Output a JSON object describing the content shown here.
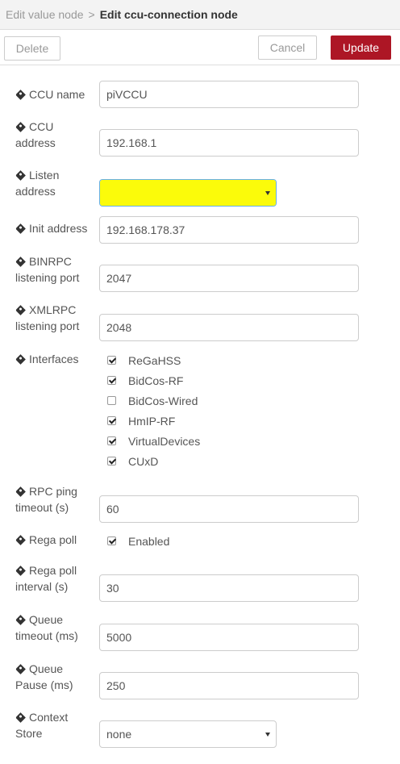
{
  "header": {
    "parent": "Edit value node",
    "separator": ">",
    "current": "Edit ccu-connection node"
  },
  "toolbar": {
    "delete_label": "Delete",
    "cancel_label": "Cancel",
    "update_label": "Update"
  },
  "form": {
    "ccu_name": {
      "label": "CCU name",
      "value": "piVCCU"
    },
    "ccu_address": {
      "label": "CCU address",
      "value": "192.168.1"
    },
    "listen_address": {
      "label": "Listen address",
      "value": ""
    },
    "init_address": {
      "label": "Init address",
      "value": "192.168.178.37"
    },
    "binrpc_port": {
      "label": "BINRPC listening port",
      "value": "2047"
    },
    "xmlrpc_port": {
      "label": "XMLRPC listening port",
      "value": "2048"
    },
    "interfaces": {
      "label": "Interfaces",
      "items": [
        {
          "label": "ReGaHSS",
          "checked": true
        },
        {
          "label": "BidCos-RF",
          "checked": true
        },
        {
          "label": "BidCos-Wired",
          "checked": false
        },
        {
          "label": "HmIP-RF",
          "checked": true
        },
        {
          "label": "VirtualDevices",
          "checked": true
        },
        {
          "label": "CUxD",
          "checked": true
        }
      ]
    },
    "rpc_ping_timeout": {
      "label": "RPC ping timeout (s)",
      "value": "60"
    },
    "rega_poll": {
      "label": "Rega poll",
      "checkbox_label": "Enabled",
      "checked": true
    },
    "rega_poll_interval": {
      "label": "Rega poll interval (s)",
      "value": "30"
    },
    "queue_timeout": {
      "label": "Queue timeout (ms)",
      "value": "5000"
    },
    "queue_pause": {
      "label": "Queue Pause (ms)",
      "value": "250"
    },
    "context_store": {
      "label": "Context Store",
      "value": "none"
    }
  },
  "icons": {
    "field_label_icon": "tag-icon",
    "dropdown_icon": "caret-down-icon",
    "checkbox_icon": "checkmark-icon"
  },
  "colors": {
    "update_button": "#ad1625",
    "highlight": "#fbfb0a",
    "header_bg": "#f3f3f3"
  }
}
